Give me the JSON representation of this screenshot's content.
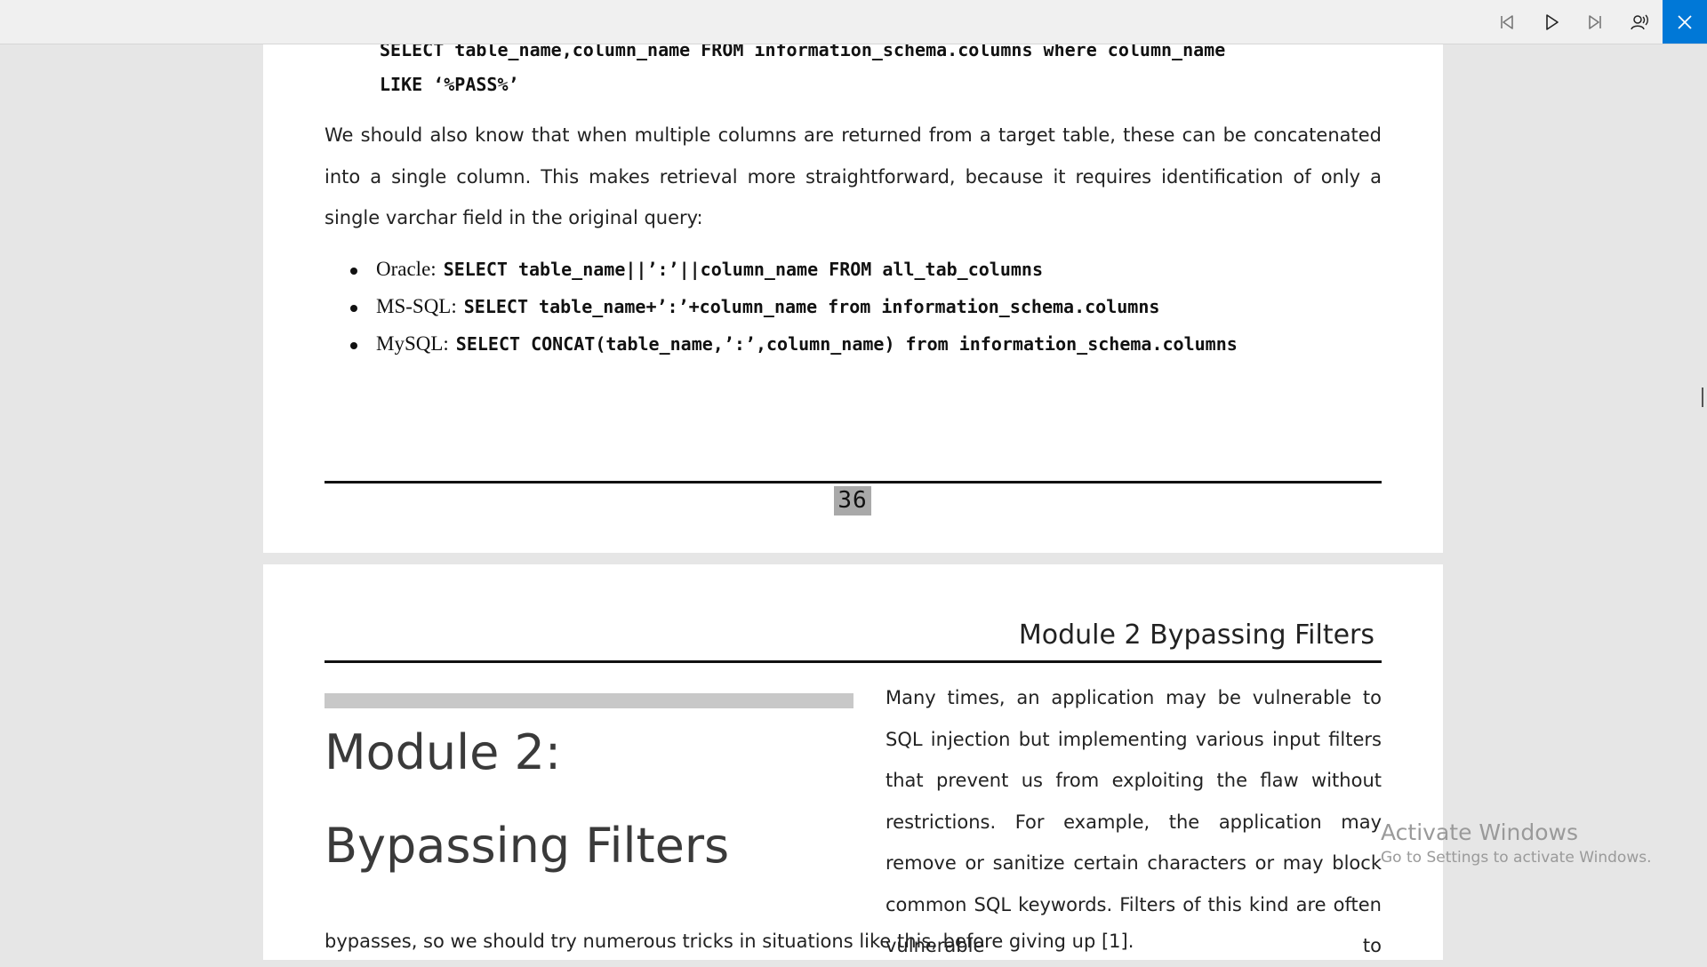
{
  "toolbar": {
    "buttons": [
      {
        "name": "previous",
        "icon": "skip-back-icon"
      },
      {
        "name": "play",
        "icon": "play-icon"
      },
      {
        "name": "next",
        "icon": "skip-forward-icon"
      },
      {
        "name": "read-aloud-voice",
        "icon": "voice-settings-icon"
      },
      {
        "name": "close",
        "icon": "close-icon"
      }
    ],
    "accent_color": "#0078d7"
  },
  "page1": {
    "query_line1": "SELECT table_name,column_name FROM information_schema.columns where column_name",
    "query_line2": "LIKE ‘%PASS%’",
    "paragraph": "We should also know that when multiple columns are returned from a target table, these can be concatenated into a single column. This makes retrieval more straightforward, because it requires identification of only a single varchar field in the original query:",
    "bullets": [
      {
        "label": "Oracle:",
        "code": "SELECT table_name||’:’||column_name FROM all_tab_columns"
      },
      {
        "label": "MS-SQL:",
        "code": "SELECT table_name+’:’+column_name from information_schema.columns"
      },
      {
        "label": "MySQL:",
        "code": "SELECT CONCAT(table_name,’:’,column_name) from information_schema.columns"
      }
    ],
    "page_number": "36"
  },
  "page2": {
    "header": "Module 2 Bypassing Filters",
    "module_title_line1": "Module 2:",
    "module_title_line2": "Bypassing Filters",
    "column_text": "Many times, an application may be vulnerable to SQL injection but implementing various input filters that prevent us from exploiting the flaw without restrictions. For example, the application may remove or sanitize certain characters or may block common SQL keywords. Filters of this kind are often vulnerable to",
    "continued_text": "bypasses, so we should try numerous tricks in situations like this, before giving up [1]."
  },
  "watermark": {
    "title": "Activate Windows",
    "subtitle": "Go to Settings to activate Windows."
  }
}
